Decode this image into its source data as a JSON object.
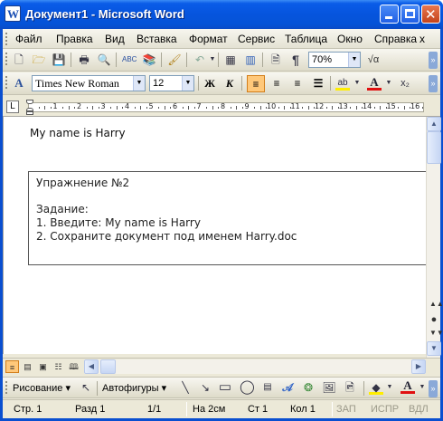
{
  "window": {
    "title": "Документ1 - Microsoft Word",
    "app_icon_letter": "W"
  },
  "menu": {
    "items": [
      "Файл",
      "Правка",
      "Вид",
      "Вставка",
      "Формат",
      "Сервис",
      "Таблица",
      "Окно",
      "Справка"
    ],
    "help_box": "x"
  },
  "standard_toolbar": {
    "icons": [
      "new-icon",
      "open-icon",
      "save-icon",
      "print-icon",
      "print-preview-icon",
      "spelling-icon",
      "research-icon",
      "format-painter-icon",
      "undo-icon",
      "insert-table-icon",
      "columns-icon",
      "drawing-icon",
      "document-map-icon",
      "show-paragraph-icon"
    ],
    "zoom": "70%",
    "paragraph_mark": "¶"
  },
  "format_toolbar": {
    "style_letter": "A",
    "font_name": "Times New Roman",
    "font_size": "12",
    "bold": "Ж",
    "italic": "К",
    "alignment_active": "align-left"
  },
  "ruler": {
    "tab_stop": "L",
    "numbers": [
      "1",
      "2",
      "3",
      "4",
      "5",
      "6",
      "7",
      "8",
      "9",
      "10",
      "11",
      "12",
      "13",
      "14",
      "15",
      "16"
    ]
  },
  "document": {
    "line1": "My name is Harry",
    "textbox": {
      "title": "Упражнение №2",
      "task_label": "Задание:",
      "step1": "1. Введите: My name is Harry",
      "step2": "2. Сохраните документ под именем Harry.doc"
    }
  },
  "drawing_toolbar": {
    "draw_label": "Рисование",
    "autoshapes_label": "Автофигуры"
  },
  "status": {
    "page": "Стр. 1",
    "section": "Разд 1",
    "pages": "1/1",
    "position": "На 2см",
    "line": "Ст 1",
    "column": "Кол 1",
    "rec": "ЗАП",
    "trk": "ИСПР",
    "ext": "ВДЛ"
  }
}
